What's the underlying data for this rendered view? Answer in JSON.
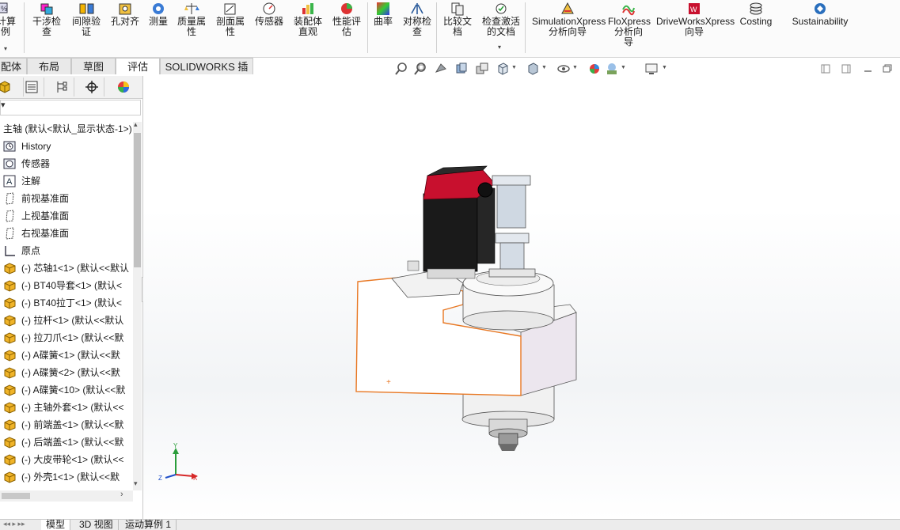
{
  "ribbon": {
    "tools": [
      {
        "name": "calc-tool",
        "label": "计算\n例",
        "icon": "calc-icon"
      },
      {
        "name": "interference-check",
        "label": "干涉检\n查",
        "icon": "interference-icon"
      },
      {
        "name": "clearance-verify",
        "label": "间隙验\n证",
        "icon": "clearance-icon"
      },
      {
        "name": "hole-alignment",
        "label": "孔对齐",
        "icon": "hole-align-icon"
      },
      {
        "name": "measure",
        "label": "测量",
        "icon": "measure-icon"
      },
      {
        "name": "mass-properties",
        "label": "质量属\n性",
        "icon": "mass-icon"
      },
      {
        "name": "section-properties",
        "label": "剖面属\n性",
        "icon": "section-icon"
      },
      {
        "name": "sensor",
        "label": "传感器",
        "icon": "sensor-icon"
      },
      {
        "name": "assembly-visualization",
        "label": "装配体\n直观",
        "icon": "assembly-vis-icon"
      },
      {
        "name": "performance-evaluation",
        "label": "性能评\n估",
        "icon": "performance-icon"
      },
      {
        "name": "curvature",
        "label": "曲率",
        "icon": "curvature-icon"
      },
      {
        "name": "symmetry-check",
        "label": "对称检\n查",
        "icon": "symmetry-icon"
      },
      {
        "name": "compare-documents",
        "label": "比较文\n档",
        "icon": "compare-icon"
      },
      {
        "name": "check-active-document",
        "label": "检查激活\n的文档",
        "icon": "check-doc-icon"
      },
      {
        "name": "simulationxpress",
        "label": "SimulationXpress\n分析向导",
        "icon": "simxpress-icon"
      },
      {
        "name": "floxpress",
        "label": "FloXpress\n分析向\n导",
        "icon": "floxpress-icon"
      },
      {
        "name": "driveworksxpress",
        "label": "DriveWorksXpress\n向导",
        "icon": "driveworks-icon"
      },
      {
        "name": "costing",
        "label": "Costing",
        "icon": "costing-icon"
      },
      {
        "name": "sustainability",
        "label": "Sustainability",
        "icon": "sustainability-icon"
      }
    ]
  },
  "tabs": [
    {
      "label": "配体",
      "active": false
    },
    {
      "label": "布局",
      "active": false
    },
    {
      "label": "草图",
      "active": false
    },
    {
      "label": "评估",
      "active": true
    },
    {
      "label": "SOLIDWORKS 插件",
      "active": false
    }
  ],
  "tree": {
    "root": "主轴 (默认<默认_显示状态-1>)",
    "items": [
      {
        "label": "History",
        "icon": "history-icon"
      },
      {
        "label": "传感器",
        "icon": "sensor-folder-icon"
      },
      {
        "label": "注解",
        "icon": "annotation-icon"
      },
      {
        "label": "前视基准面",
        "icon": "plane-icon"
      },
      {
        "label": "上视基准面",
        "icon": "plane-icon"
      },
      {
        "label": "右视基准面",
        "icon": "plane-icon"
      },
      {
        "label": "原点",
        "icon": "origin-icon"
      },
      {
        "label": "(-) 芯轴1<1> (默认<<默认",
        "icon": "part-icon"
      },
      {
        "label": "(-) BT40导套<1> (默认<",
        "icon": "part-icon"
      },
      {
        "label": "(-) BT40拉丁<1> (默认<",
        "icon": "part-icon"
      },
      {
        "label": "(-) 拉杆<1> (默认<<默认",
        "icon": "part-icon"
      },
      {
        "label": "(-) 拉刀爪<1> (默认<<默",
        "icon": "part-icon"
      },
      {
        "label": "(-) A碟簧<1> (默认<<默",
        "icon": "part-icon"
      },
      {
        "label": "(-) A碟簧<2> (默认<<默",
        "icon": "part-icon"
      },
      {
        "label": "(-) A碟簧<10> (默认<<默",
        "icon": "part-icon"
      },
      {
        "label": "(-) 主轴外套<1> (默认<<",
        "icon": "part-icon"
      },
      {
        "label": "(-) 前端盖<1> (默认<<默",
        "icon": "part-icon"
      },
      {
        "label": "(-) 后端盖<1> (默认<<默",
        "icon": "part-icon"
      },
      {
        "label": "(-) 大皮带轮<1> (默认<<",
        "icon": "part-icon"
      },
      {
        "label": "(-) 外壳1<1> (默认<<默",
        "icon": "part-icon"
      }
    ]
  },
  "bottom_tabs": [
    {
      "label": "模型",
      "active": true
    },
    {
      "label": "3D 视图",
      "active": false
    },
    {
      "label": "运动算例 1",
      "active": false
    }
  ],
  "triad": {
    "x": "X",
    "y": "Y",
    "z": "Z"
  },
  "colors": {
    "accent": "#e87722",
    "motor_red": "#c8102e",
    "motor_black": "#1a1a1a",
    "axis_x": "#d62828",
    "axis_y": "#2a9d3a",
    "axis_z": "#1f4fc9"
  }
}
